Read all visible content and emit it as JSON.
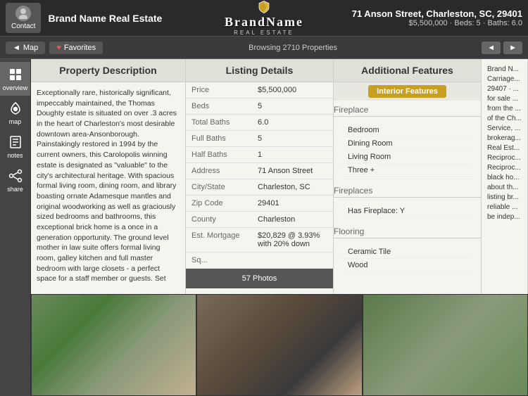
{
  "header": {
    "contact_label": "Contact",
    "brand_name": "Brand Name Real Estate",
    "logo_line1": "BrandName",
    "logo_line2": "REAL ESTATE",
    "address": "71 Anson Street, Charleston, SC, 29401",
    "price": "$5,500,000",
    "beds": "Beds: 5",
    "baths": "Baths: 6.0",
    "price_beds_baths": "$5,500,000 · Beds: 5 · Baths: 6.0"
  },
  "navbar": {
    "map_label": "Map",
    "favorites_label": "Favorites",
    "browse_info": "Browsing 2710 Properties",
    "prev_label": "◄",
    "next_label": "►"
  },
  "sidebar": {
    "items": [
      {
        "id": "overview",
        "label": "overview",
        "active": true
      },
      {
        "id": "map",
        "label": "map",
        "active": false
      },
      {
        "id": "notes",
        "label": "notes",
        "active": false
      },
      {
        "id": "share",
        "label": "share",
        "active": false
      }
    ]
  },
  "property_description": {
    "title": "Property Description",
    "body": "Exceptionally rare, historically significant, impeccably maintained, the Thomas Doughty estate is situated on over .3 acres in the heart of Charleston's most desirable downtown area-Ansonborough. Painstakingly restored in 1994 by the current owners, this Carolopolis winning estate is designated as \"valuable\" to the city's architectural heritage. With spacious formal living room, dining room, and library boasting ornate Adamesque mantles and original woodworking as well as graciously sized bedrooms and bathrooms, this exceptional brick home is a once in a generation opportunity. The ground level mother in law suite offers formal living room, galley kitchen and full master bedroom with large closets - a perfect space for a staff member or guests. Set"
  },
  "listing_details": {
    "title": "Listing Details",
    "rows": [
      {
        "label": "Price",
        "value": "$5,500,000"
      },
      {
        "label": "Beds",
        "value": "5"
      },
      {
        "label": "Total Baths",
        "value": "6.0"
      },
      {
        "label": "Full Baths",
        "value": "5"
      },
      {
        "label": "Half Baths",
        "value": "1"
      },
      {
        "label": "Address",
        "value": "71 Anson Street"
      },
      {
        "label": "City/State",
        "value": "Charleston, SC"
      },
      {
        "label": "Zip Code",
        "value": "29401"
      },
      {
        "label": "County",
        "value": "Charleston"
      },
      {
        "label": "Est. Mortgage",
        "value": "$20,829 @ 3.93% with 20% down"
      },
      {
        "label": "Sq...",
        "value": ""
      }
    ],
    "photos_count": "57 Photos"
  },
  "additional_features": {
    "title": "Additional Features",
    "active_tab": "Interior Features",
    "sections": [
      {
        "title": "Fireplace",
        "items": [
          "Bedroom",
          "Dining Room",
          "Living Room",
          "Three +"
        ]
      },
      {
        "title": "Fireplaces",
        "items": [
          "Has Fireplace: Y"
        ]
      },
      {
        "title": "Flooring",
        "items": [
          "Ceramic Tile",
          "Wood"
        ]
      }
    ]
  },
  "right_panel": {
    "body": "Brand N... Carriage... 29407 · ... for sale .... from the ... of the Ch... Service, ... brokerag... Real Est... Reciproc... Reciproc... black ho... about th... listing br... reliable ... be indep... ...cu subj..."
  },
  "photos": {
    "count_label": "57 Photos",
    "items": [
      {
        "alt": "Estate exterior front"
      },
      {
        "alt": "Door entrance brick"
      },
      {
        "alt": "Trees exterior side"
      }
    ]
  }
}
